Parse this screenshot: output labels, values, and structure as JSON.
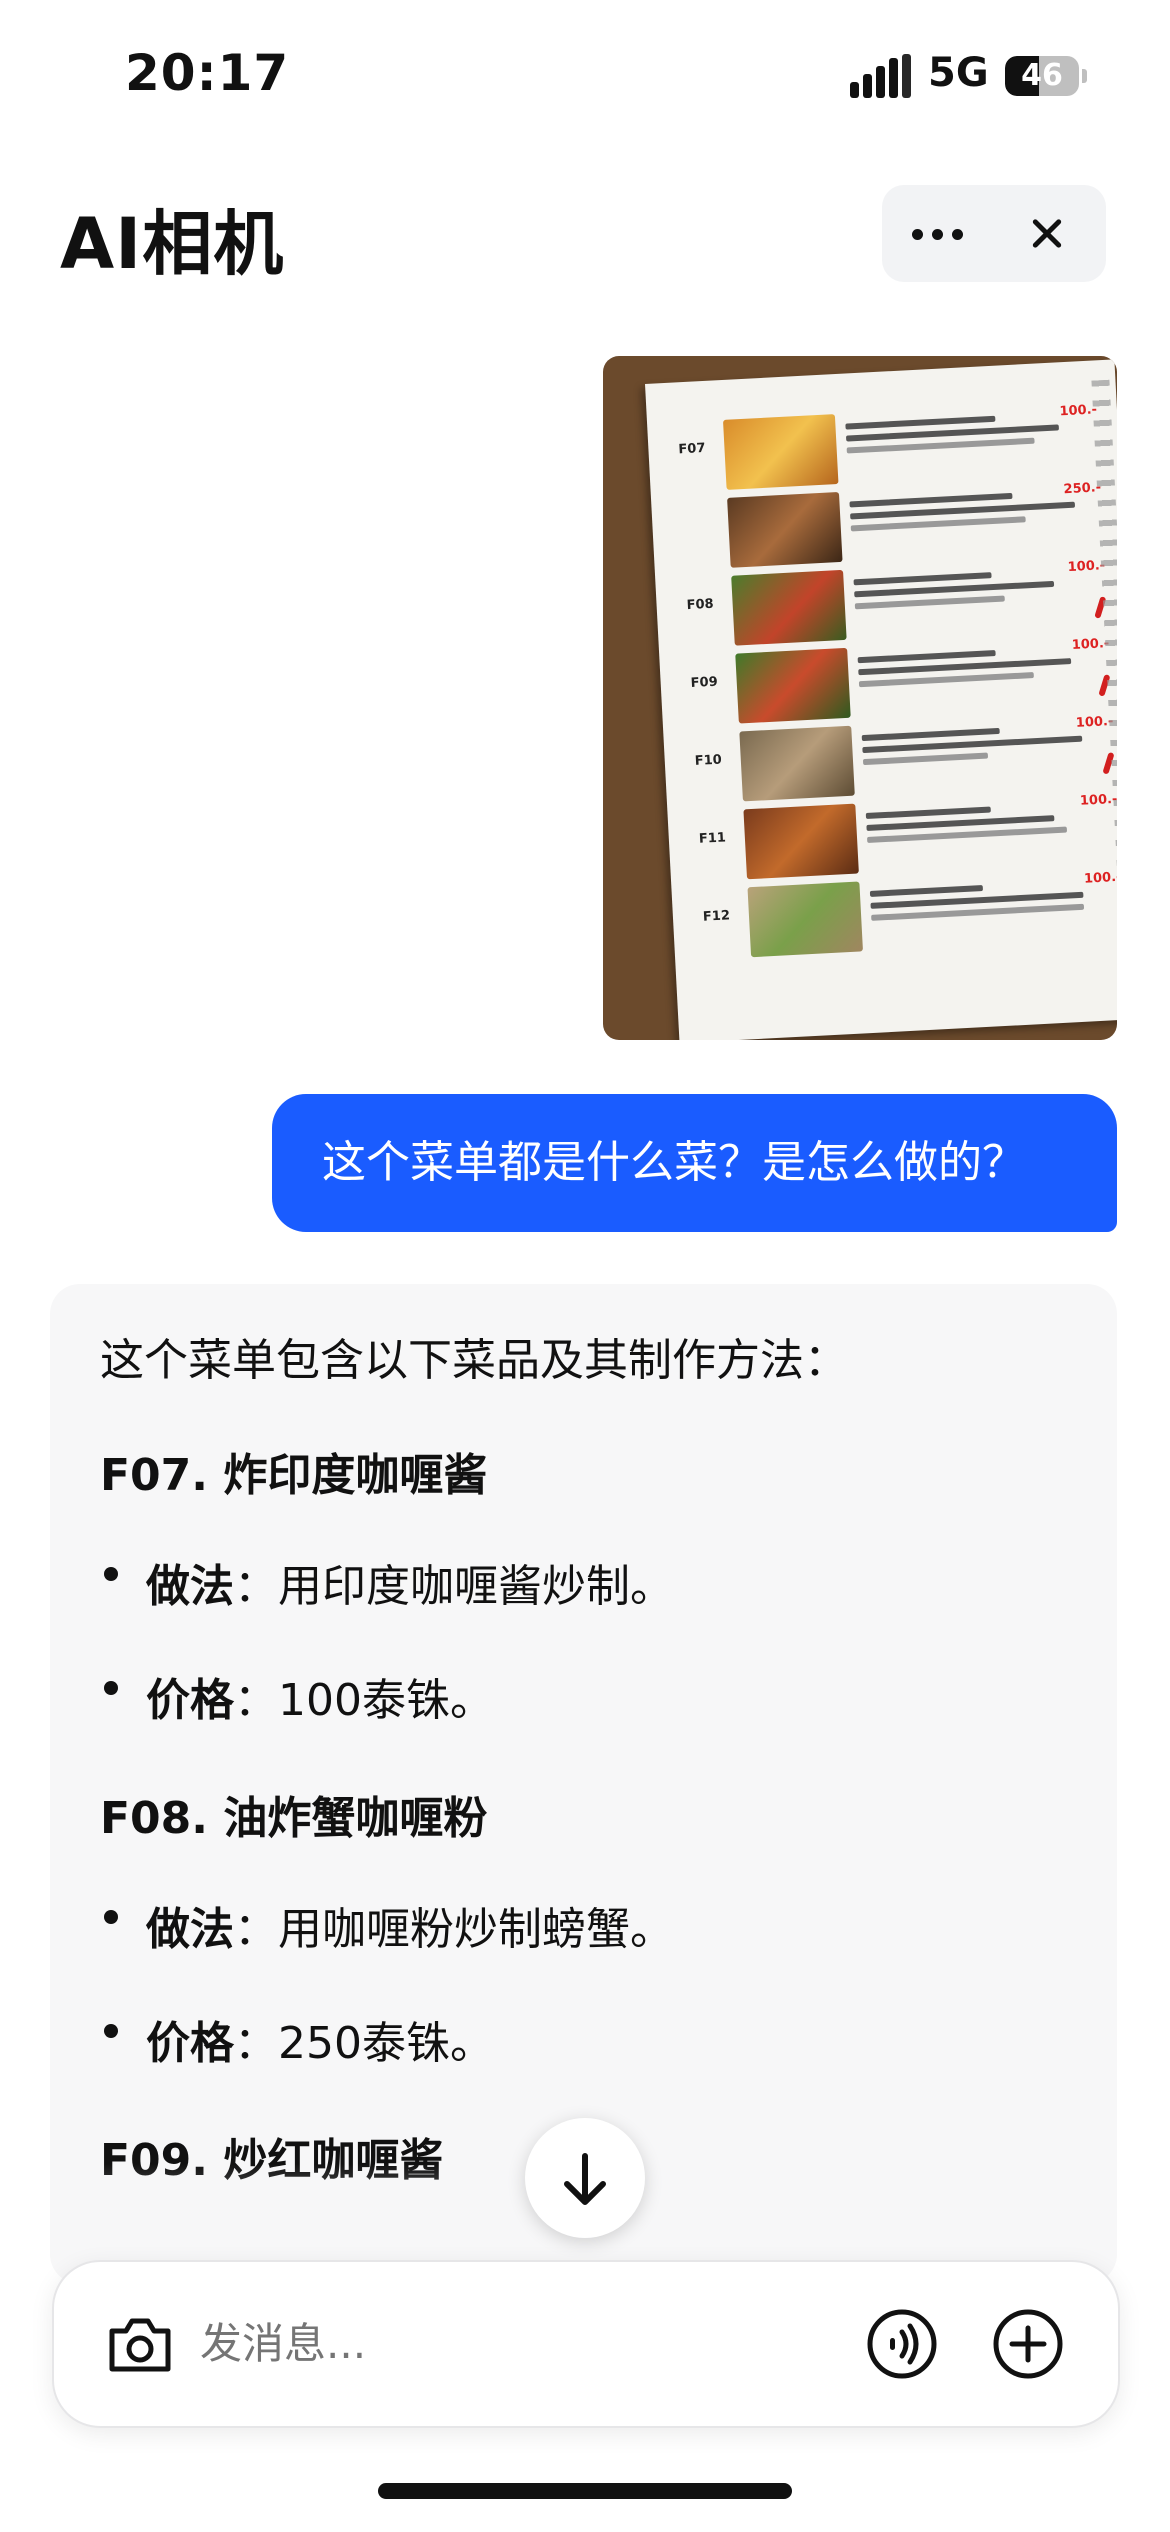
{
  "status_bar": {
    "time": "20:17",
    "network": "5G",
    "battery": "46",
    "battery_level": 0.46
  },
  "header": {
    "title": "AI相机",
    "more_icon": "more-horizontal-icon",
    "close_icon": "close-icon"
  },
  "user_message": {
    "text": "这个菜单都是什么菜？是怎么做的？"
  },
  "answer": {
    "intro": "这个菜单包含以下菜品及其制作方法：",
    "dishes": [
      {
        "heading": "F07. 炸印度咖喱酱",
        "method_label": "做法",
        "method": "：用印度咖喱酱炒制。",
        "price_label": "价格",
        "price": "：100泰铢。"
      },
      {
        "heading": "F08. 油炸蟹咖喱粉",
        "method_label": "做法",
        "method": "：用咖喱粉炒制螃蟹。",
        "price_label": "价格",
        "price": "：250泰铢。"
      },
      {
        "heading": "F09. 炒红咖喱酱"
      }
    ]
  },
  "input_bar": {
    "placeholder": "发消息...",
    "camera_icon": "camera-icon",
    "voice_icon": "voice-call-icon",
    "plus_icon": "plus-circle-icon"
  },
  "colors": {
    "accent": "#1a5cff",
    "answer_bg": "#f7f7f8"
  }
}
